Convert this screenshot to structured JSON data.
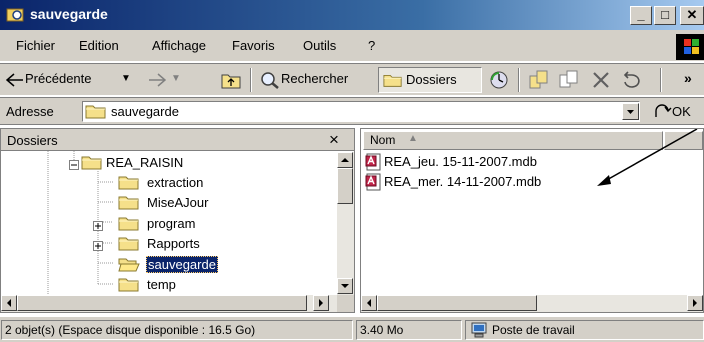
{
  "window": {
    "title": "sauvegarde"
  },
  "menu": [
    "Fichier",
    "Edition",
    "Affichage",
    "Favoris",
    "Outils",
    "?"
  ],
  "toolbar": {
    "back": "Précédente",
    "search": "Rechercher",
    "folders": "Dossiers",
    "more": "»"
  },
  "address": {
    "label": "Adresse",
    "value": "sauvegarde",
    "go": "OK"
  },
  "folders_pane": {
    "title": "Dossiers",
    "close": "×",
    "items": [
      {
        "label": "REA_RAISIN",
        "expander": "-"
      },
      {
        "label": "extraction",
        "expander": ""
      },
      {
        "label": "MiseAJour",
        "expander": ""
      },
      {
        "label": "program",
        "expander": "+"
      },
      {
        "label": "Rapports",
        "expander": "+"
      },
      {
        "label": "sauvegarde",
        "expander": "",
        "selected": true
      },
      {
        "label": "temp",
        "expander": ""
      }
    ]
  },
  "file_list": {
    "column": "Nom",
    "files": [
      "REA_jeu. 15-11-2007.mdb",
      "REA_mer. 14-11-2007.mdb"
    ]
  },
  "status": {
    "objects": "2 objet(s) (Espace disque disponible : 16.5 Go)",
    "size": "3.40 Mo",
    "zone": "Poste de travail"
  },
  "colors": {
    "title_start": "#0a246a",
    "title_end": "#a6caf0",
    "chrome": "#d4d0c8",
    "selection": "#0a246a"
  },
  "icons": [
    "folder-icon",
    "mdb-file-icon",
    "back-arrow-icon",
    "forward-arrow-icon",
    "up-folder-icon",
    "search-icon",
    "folders-icon",
    "history-icon",
    "move-icon",
    "copy-icon",
    "delete-icon",
    "undo-icon",
    "computer-icon",
    "go-icon"
  ]
}
